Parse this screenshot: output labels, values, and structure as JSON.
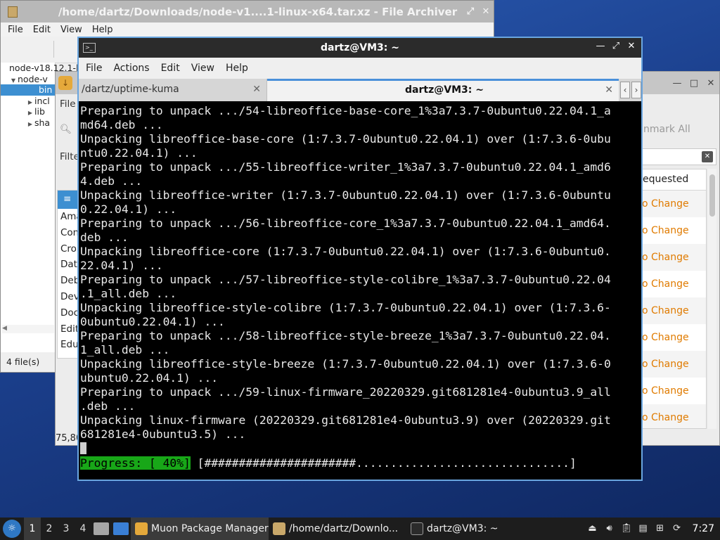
{
  "archiver": {
    "title": "/home/dartz/Downloads/node-v1....1-linux-x64.tar.xz - File Archiver",
    "menu": [
      "File",
      "Edit",
      "View",
      "Help"
    ],
    "tree": [
      {
        "label": "node-v18.12.1-li",
        "expander": "",
        "indent": 0
      },
      {
        "label": "node-v",
        "expander": "▼",
        "indent": 1
      },
      {
        "label": "bin",
        "expander": "",
        "indent": 2,
        "selected": true
      },
      {
        "label": "incl",
        "expander": "▶",
        "indent": 2
      },
      {
        "label": "lib",
        "expander": "▶",
        "indent": 2
      },
      {
        "label": "sha",
        "expander": "▶",
        "indent": 2
      }
    ],
    "status": "4 file(s)"
  },
  "muon": {
    "title": "Muon Package Manager",
    "frag_file": "File",
    "frag_filter": "Filte",
    "mark_all": "nmark All",
    "requested_header": "equested",
    "categories_visible": [
      "Ama",
      "Con",
      "Cro",
      "Dat",
      "Deb",
      "Dev",
      "Doc",
      "Edit",
      "Edu"
    ],
    "changes": [
      "o Change",
      "o Change",
      "o Change",
      "o Change",
      "o Change",
      "o Change",
      "o Change",
      "o Change",
      "o Change"
    ],
    "bottom_value": "75,80"
  },
  "terminal": {
    "title": "dartz@VM3: ~",
    "menu": [
      "File",
      "Actions",
      "Edit",
      "View",
      "Help"
    ],
    "tabs": [
      {
        "label": "/dartz/uptime-kuma",
        "active": false
      },
      {
        "label": "dartz@VM3: ~",
        "active": true
      }
    ],
    "lines": [
      "Preparing to unpack .../54-libreoffice-base-core_1%3a7.3.7-0ubuntu0.22.04.1_a",
      "md64.deb ...",
      "Unpacking libreoffice-base-core (1:7.3.7-0ubuntu0.22.04.1) over (1:7.3.6-0ubu",
      "ntu0.22.04.1) ...",
      "Preparing to unpack .../55-libreoffice-writer_1%3a7.3.7-0ubuntu0.22.04.1_amd6",
      "4.deb ...",
      "Unpacking libreoffice-writer (1:7.3.7-0ubuntu0.22.04.1) over (1:7.3.6-0ubuntu",
      "0.22.04.1) ...",
      "Preparing to unpack .../56-libreoffice-core_1%3a7.3.7-0ubuntu0.22.04.1_amd64.",
      "deb ...",
      "Unpacking libreoffice-core (1:7.3.7-0ubuntu0.22.04.1) over (1:7.3.6-0ubuntu0.",
      "22.04.1) ...",
      "Preparing to unpack .../57-libreoffice-style-colibre_1%3a7.3.7-0ubuntu0.22.04",
      ".1_all.deb ...",
      "Unpacking libreoffice-style-colibre (1:7.3.7-0ubuntu0.22.04.1) over (1:7.3.6-",
      "0ubuntu0.22.04.1) ...",
      "Preparing to unpack .../58-libreoffice-style-breeze_1%3a7.3.7-0ubuntu0.22.04.",
      "1_all.deb ...",
      "Unpacking libreoffice-style-breeze (1:7.3.7-0ubuntu0.22.04.1) over (1:7.3.6-0",
      "ubuntu0.22.04.1) ...",
      "Preparing to unpack .../59-linux-firmware_20220329.git681281e4-0ubuntu3.9_all",
      ".deb ...",
      "Unpacking linux-firmware (20220329.git681281e4-0ubuntu3.9) over (20220329.git",
      "681281e4-0ubuntu3.5) ..."
    ],
    "progress_label": "Progress: [ 40%]",
    "progress_bar": " [######################...............................]"
  },
  "taskbar": {
    "workspaces": [
      "1",
      "2",
      "3",
      "4"
    ],
    "current_workspace": "1",
    "tasks": [
      {
        "label": "Muon Package Manager",
        "active": true,
        "icon_color": "#e5a93b"
      },
      {
        "label": "/home/dartz/Downlo...",
        "active": false,
        "icon_color": "#c9a86a"
      },
      {
        "label": "dartz@VM3: ~",
        "active": false,
        "icon_color": "#2b2b2b"
      }
    ],
    "clock": "7:27"
  },
  "colors": {
    "selection": "#3d8fd1",
    "progress_green": "#18a718",
    "muon_change_orange": "#e07b00",
    "terminal_accent": "#6aa6e0"
  }
}
